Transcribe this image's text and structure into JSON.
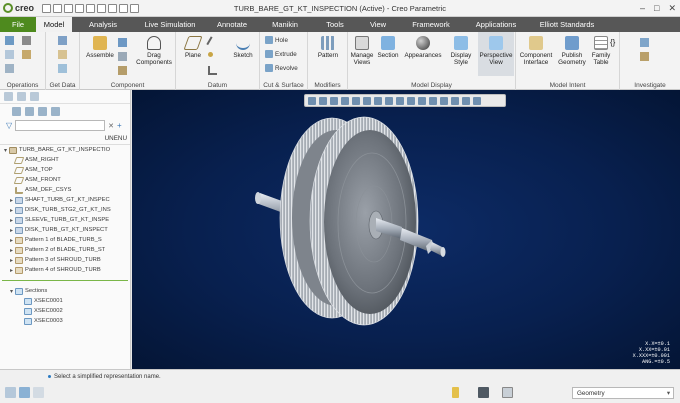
{
  "app": {
    "logo": "creo",
    "window_title": "TURB_BARE_GT_KT_INSPECTION (Active) - Creo Parametric",
    "window_controls": [
      "–",
      "□",
      "✕"
    ]
  },
  "tabs": [
    "File",
    "Model",
    "Analysis",
    "Live Simulation",
    "Annotate",
    "Manikin",
    "Tools",
    "View",
    "Framework",
    "Applications",
    "Elliott Standards"
  ],
  "ribbon": {
    "operations": {
      "label": "Operations"
    },
    "get_data": {
      "label": "Get Data"
    },
    "component": {
      "label": "Component",
      "assemble": "Assemble",
      "drag": "Drag\nComponents"
    },
    "datum": {
      "label": "Datum",
      "plane": "Plane",
      "sketch": "Sketch"
    },
    "cut_surface": {
      "label": "Cut & Surface",
      "hole": "Hole",
      "extrude": "Extrude",
      "revolve": "Revolve"
    },
    "modifiers": {
      "label": "Modifiers",
      "pattern": "Pattern"
    },
    "model_display": {
      "label": "Model Display",
      "manage_views": "Manage\nViews",
      "section": "Section",
      "appearances": "Appearances",
      "display_style": "Display\nStyle",
      "perspective_view": "Perspective\nView"
    },
    "model_intent": {
      "label": "Model Intent",
      "component_interface": "Component\nInterface",
      "publish_geometry": "Publish\nGeometry",
      "family_table": "Family\nTable"
    },
    "investigate": {
      "label": "Investigate"
    }
  },
  "model_tree": {
    "column_header": "UNENU",
    "root": "TURB_BARE_GT_KT_INSPECTIO",
    "items": [
      {
        "label": "ASM_RIGHT",
        "icon": "datum-plane-icon",
        "expandable": false
      },
      {
        "label": "ASM_TOP",
        "icon": "datum-plane-icon",
        "expandable": false
      },
      {
        "label": "ASM_FRONT",
        "icon": "datum-plane-icon",
        "expandable": false
      },
      {
        "label": "ASM_DEF_CSYS",
        "icon": "csys-icon",
        "expandable": false
      },
      {
        "label": "SHAFT_TURB_GT_KT_INSPEC",
        "icon": "part-icon",
        "expandable": true
      },
      {
        "label": "DISK_TURB_STG2_GT_KT_INS",
        "icon": "part-icon",
        "expandable": true
      },
      {
        "label": "SLEEVE_TURB_GT_KT_INSPE",
        "icon": "part-icon",
        "expandable": true
      },
      {
        "label": "DISK_TURB_GT_KT_INSPECT",
        "icon": "part-icon",
        "expandable": true
      },
      {
        "label": "Pattern 1 of BLADE_TURB_S",
        "icon": "pattern-icon",
        "expandable": true
      },
      {
        "label": "Pattern 2 of BLADE_TURB_ST",
        "icon": "pattern-icon",
        "expandable": true
      },
      {
        "label": "Pattern 3 of SHROUD_TURB",
        "icon": "pattern-icon",
        "expandable": true
      },
      {
        "label": "Pattern 4 of SHROUD_TURB",
        "icon": "pattern-icon",
        "expandable": true
      }
    ],
    "sections_root": "Sections",
    "sections": [
      "XSEC0001",
      "XSEC0002",
      "XSEC0003"
    ]
  },
  "viewport": {
    "tolerance": [
      "X.X=±0.1",
      "X.XX=±0.01",
      "X.XXX=±0.001",
      "ANG.=±0.5"
    ]
  },
  "status": {
    "message": "Select a simplified representation name.",
    "filter": "Geometry"
  },
  "colors": {
    "file_tab": "#4e8a1e",
    "ribbon_bar": "#575757",
    "viewport": "#0b2455",
    "accent": "#7ab648"
  }
}
